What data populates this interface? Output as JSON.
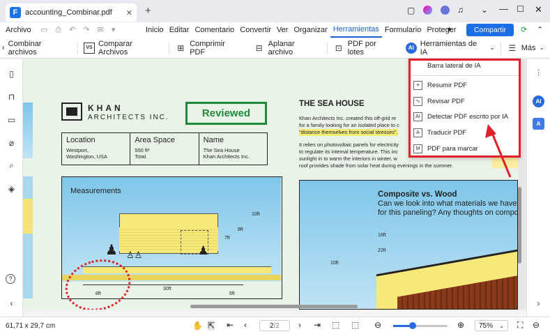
{
  "window": {
    "tab_title": "accounting_Combinar.pdf",
    "new_tab": "+"
  },
  "menu": {
    "archivo": "Archivo",
    "items": [
      "Inicio",
      "Editar",
      "Comentario",
      "Convertir",
      "Ver",
      "Organizar",
      "Herramientas",
      "Formulario",
      "Proteger"
    ],
    "share_button": "Compartir"
  },
  "toolbar": {
    "combinar": "Combinar archivos",
    "comparar": "Comparar Archivos",
    "comprimir": "Comprimir PDF",
    "aplanar": "Aplanar archivo",
    "lotes": "PDF por lotes",
    "ia": "Herramientas de IA",
    "mas": "Más"
  },
  "dropdown": {
    "header": "Barra lateral de IA",
    "items": [
      "Resumir PDF",
      "Revisar PDF",
      "Detectar PDF escrito por IA",
      "Traducir PDF",
      "PDF para marcar"
    ]
  },
  "document": {
    "logo_name": "KHAN",
    "logo_sub": "ARCHITECTS INC.",
    "stamp": "Reviewed",
    "location_label": "Location",
    "location_value": "Westport,\nWashington, USA",
    "area_label": "Area Space",
    "area_value": "550 ft²\nTotal",
    "name_label": "Name",
    "name_value": "The Sea House\nKhan Architects Inc.",
    "heading": "THE SEA HOUSE",
    "para1": "Khan Architects Inc. created this off-grid re",
    "para1b": "for a family looking for an isolated place to c",
    "para1c": "\"distance themselves from social stresses\".",
    "para2": "It relies on photovoltaic panels for electricity",
    "para2b": "to regulate its internal temperature. This inc",
    "para2c": "sunlight in to warm the interiors in winter, w",
    "para2d": "roof provides shade from solar heat during evenings in the summer.",
    "measurements": "Measurements",
    "dims": [
      "10ft",
      "8ft",
      "7ft",
      "30ft",
      "8ft",
      "6ft"
    ],
    "composite_title": "Composite vs. Wood",
    "composite_q1": "Can we look into what materials we have",
    "composite_q2": "for this paneling? Any thoughts on compo",
    "right_dims": [
      "16ft",
      "22ft",
      "10ft"
    ]
  },
  "status": {
    "size": "61,71 x 29,7 cm",
    "page": "2",
    "total": "/2",
    "zoom": "75%"
  },
  "colors": {
    "accent": "#1a5fd0",
    "highlight_red": "#e0202b",
    "reviewed_green": "#1f8a3a"
  }
}
